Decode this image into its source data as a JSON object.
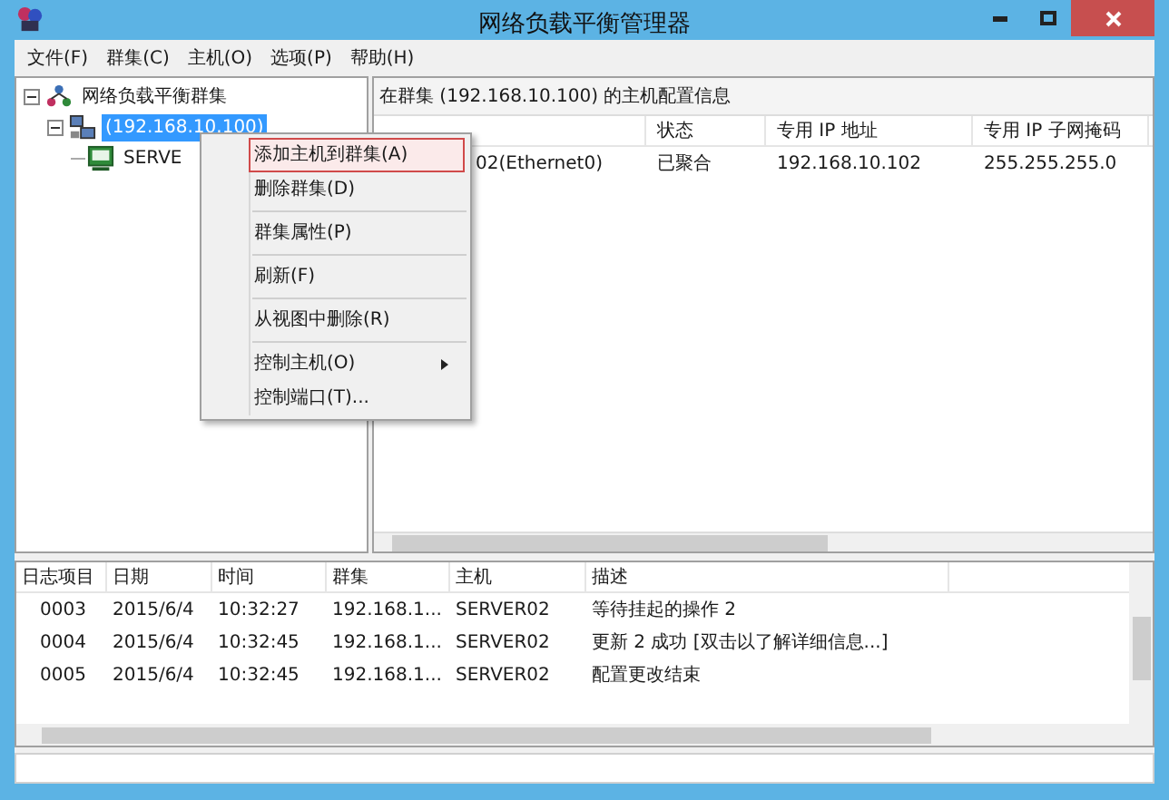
{
  "window": {
    "title": "网络负载平衡管理器"
  },
  "menu_bar": [
    {
      "label": "文件(F)"
    },
    {
      "label": "群集(C)"
    },
    {
      "label": "主机(O)"
    },
    {
      "label": "选项(P)"
    },
    {
      "label": "帮助(H)"
    }
  ],
  "tree": [
    {
      "label": "网络负载平衡群集",
      "kind": "root",
      "expanded": true,
      "selected": false,
      "children": [
        {
          "label": "(192.168.10.100)",
          "kind": "cluster",
          "expanded": true,
          "selected": true,
          "children": [
            {
              "label": "SERVE",
              "kind": "host",
              "selected": false
            }
          ]
        }
      ]
    }
  ],
  "host_panel": {
    "title": "在群集  (192.168.10.100) 的主机配置信息",
    "columns": [
      "状态",
      "专用 IP 地址",
      "专用 IP 子网掩码"
    ],
    "rows": [
      {
        "host": "02(Ethernet0)",
        "cells": [
          "已聚合",
          "192.168.10.102",
          "255.255.255.0"
        ]
      }
    ]
  },
  "context_menu": [
    {
      "kind": "item",
      "label": "添加主机到群集(A)",
      "selected": true,
      "submenu": false
    },
    {
      "kind": "item",
      "label": "删除群集(D)",
      "selected": false,
      "submenu": false
    },
    {
      "kind": "separator"
    },
    {
      "kind": "item",
      "label": "群集属性(P)",
      "selected": false,
      "submenu": false
    },
    {
      "kind": "separator"
    },
    {
      "kind": "item",
      "label": "刷新(F)",
      "selected": false,
      "submenu": false
    },
    {
      "kind": "separator"
    },
    {
      "kind": "item",
      "label": "从视图中删除(R)",
      "selected": false,
      "submenu": false
    },
    {
      "kind": "separator"
    },
    {
      "kind": "item",
      "label": "控制主机(O)",
      "selected": false,
      "submenu": true
    },
    {
      "kind": "item",
      "label": "控制端口(T)...",
      "selected": false,
      "submenu": false
    }
  ],
  "log": {
    "columns": [
      "日志项目",
      "日期",
      "时间",
      "群集",
      "主机",
      "描述"
    ],
    "rows": [
      [
        "0003",
        "2015/6/4",
        "10:32:27",
        "192.168.1...",
        "SERVER02",
        "等待挂起的操作 2"
      ],
      [
        "0004",
        "2015/6/4",
        "10:32:45",
        "192.168.1...",
        "SERVER02",
        "更新 2 成功 [双击以了解详细信息...]"
      ],
      [
        "0005",
        "2015/6/4",
        "10:32:45",
        "192.168.1...",
        "SERVER02",
        "配置更改结束"
      ]
    ]
  }
}
